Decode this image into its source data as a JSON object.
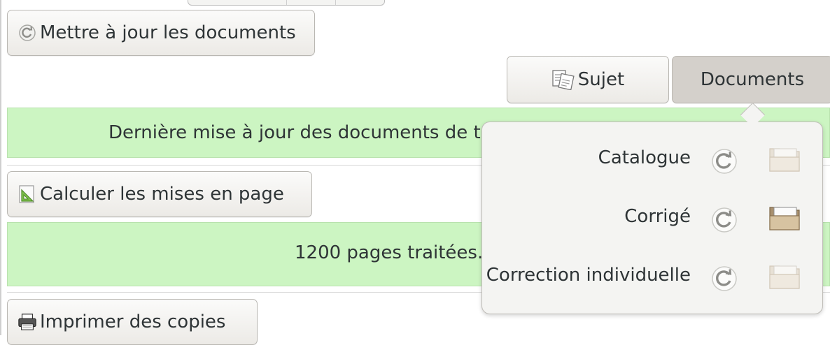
{
  "buttons": {
    "update_documents": "Mettre à jour les documents",
    "subject_tab": "Sujet",
    "documents_tab": "Documents",
    "compute_layouts": "Calculer les mises en page",
    "print_copies": "Imprimer des copies"
  },
  "status": {
    "documents_update": "Dernière mise à jour des documents de tr",
    "pages_processed": "1200 pages traitées."
  },
  "popover": {
    "items": [
      {
        "label": "Catalogue",
        "folder_state": "disabled"
      },
      {
        "label": "Corrigé",
        "folder_state": "enabled"
      },
      {
        "label": "Correction individuelle",
        "folder_state": "disabled"
      }
    ]
  },
  "colors": {
    "banner": "#ccf5c2",
    "pressed_button": "#d4d0cb",
    "popover_bg": "#f4f4f2"
  },
  "icons": {
    "update": "refresh-icon",
    "subject": "documents-copy-icon",
    "layout": "set-square-icon",
    "print": "printer-icon",
    "row_action": "refresh-icon",
    "row_open": "folder-icon"
  }
}
